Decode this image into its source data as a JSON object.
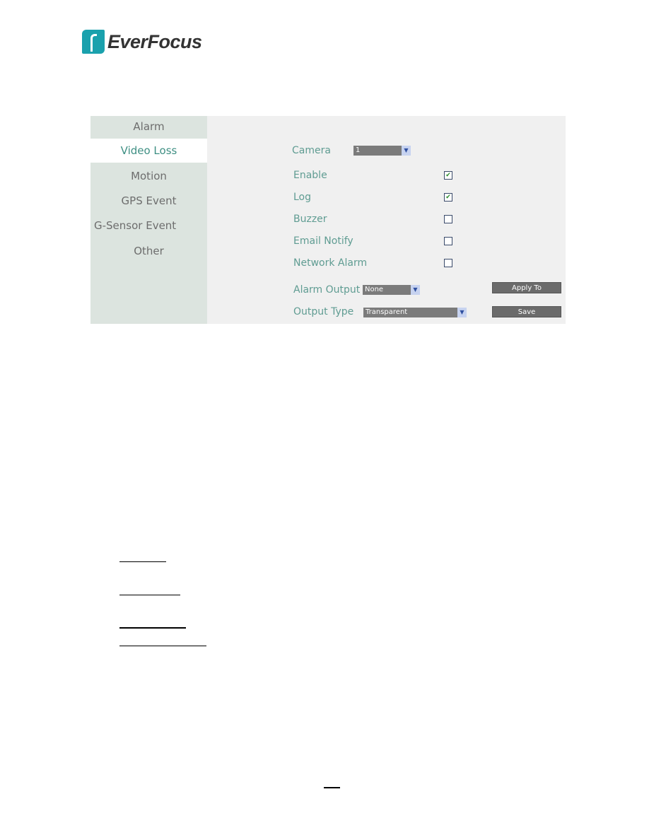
{
  "logo": {
    "text": "EverFocus",
    "color": "#1aa1ad"
  },
  "sidebar": {
    "items": [
      {
        "label": "Alarm"
      },
      {
        "label": "Video Loss",
        "selected": true
      },
      {
        "label": "Motion"
      },
      {
        "label": "GPS Event"
      },
      {
        "label": "G-Sensor Event"
      },
      {
        "label": "Other"
      }
    ]
  },
  "form": {
    "camera_label": "Camera",
    "camera_value": "1",
    "checkboxes": [
      {
        "label": "Enable",
        "checked": true
      },
      {
        "label": "Log",
        "checked": true
      },
      {
        "label": "Buzzer",
        "checked": false
      },
      {
        "label": "Email Notify",
        "checked": false
      },
      {
        "label": "Network Alarm",
        "checked": false
      }
    ],
    "alarm_output_label": "Alarm Output",
    "alarm_output_value": "None",
    "output_type_label": "Output Type",
    "output_type_value": "Transparent",
    "apply_to": "Apply To",
    "save": "Save"
  }
}
